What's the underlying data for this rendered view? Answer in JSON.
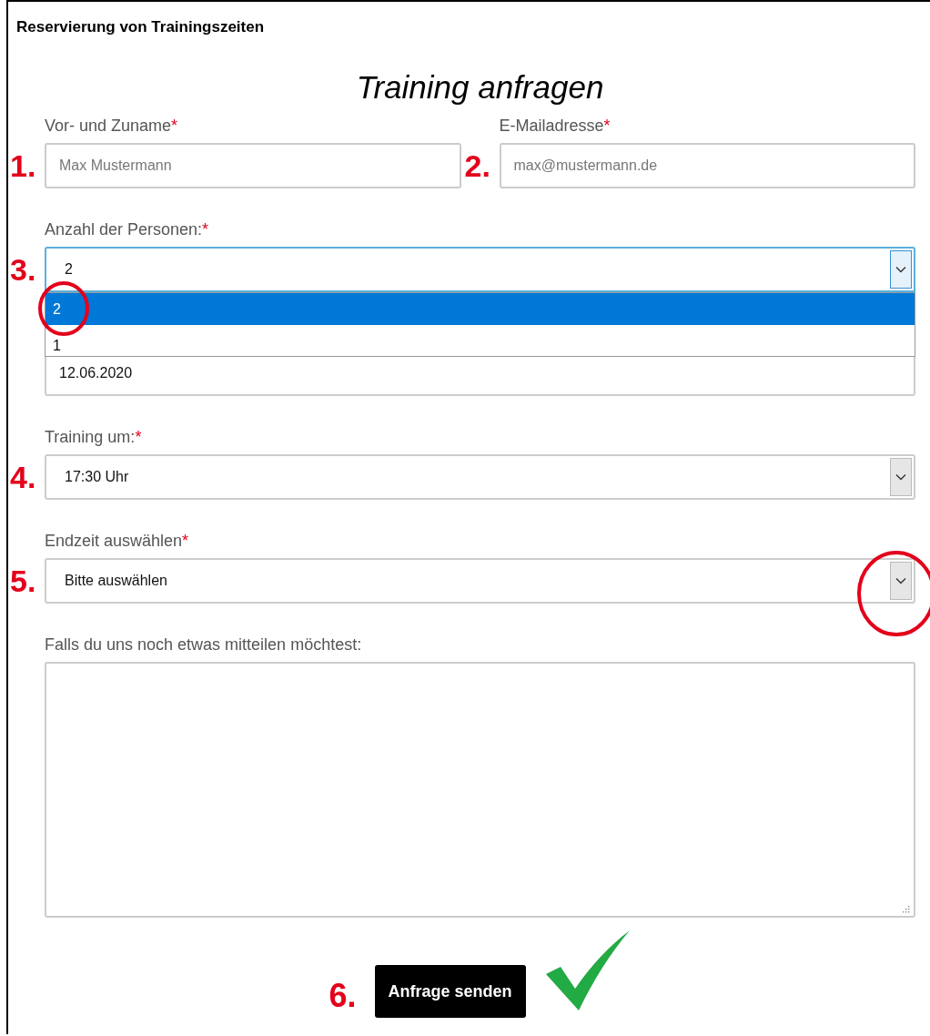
{
  "header": {
    "title": "Reservierung von Trainingszeiten"
  },
  "form": {
    "heading": "Training anfragen",
    "rows": [
      [
        {
          "kind": "text",
          "label": "Vor- und Zuname",
          "required_mark": "*",
          "placeholder": "Max Mustermann",
          "marker": "1."
        },
        {
          "kind": "text",
          "label": "E-Mailadresse",
          "required_mark": "*",
          "placeholder": "max@mustermann.de",
          "marker": "2."
        }
      ],
      [
        {
          "kind": "select",
          "label": "Anzahl der Personen:",
          "required_mark": "*",
          "value": "2",
          "focused": true,
          "expanded": true,
          "marker": "3.",
          "arrow_circled": false,
          "options": [
            {
              "label": "2",
              "selected": true,
              "circled": true
            },
            {
              "label": "1",
              "selected": false,
              "circled": false
            }
          ]
        }
      ],
      [
        {
          "kind": "date",
          "value": "12.06.2020"
        }
      ],
      [
        {
          "kind": "select",
          "label": "Training um:",
          "required_mark": "*",
          "value": "17:30 Uhr",
          "focused": false,
          "expanded": false,
          "marker": "4.",
          "arrow_circled": false
        }
      ],
      [
        {
          "kind": "select",
          "label": "Endzeit auswählen",
          "required_mark": "*",
          "value": "Bitte auswählen",
          "focused": false,
          "expanded": false,
          "marker": "5.",
          "arrow_circled": true
        }
      ],
      [
        {
          "kind": "textarea",
          "label": "Falls du uns noch etwas mitteilen möchtest:"
        }
      ]
    ],
    "submit": {
      "label": "Anfrage senden",
      "marker": "6.",
      "confirmed": true
    }
  }
}
